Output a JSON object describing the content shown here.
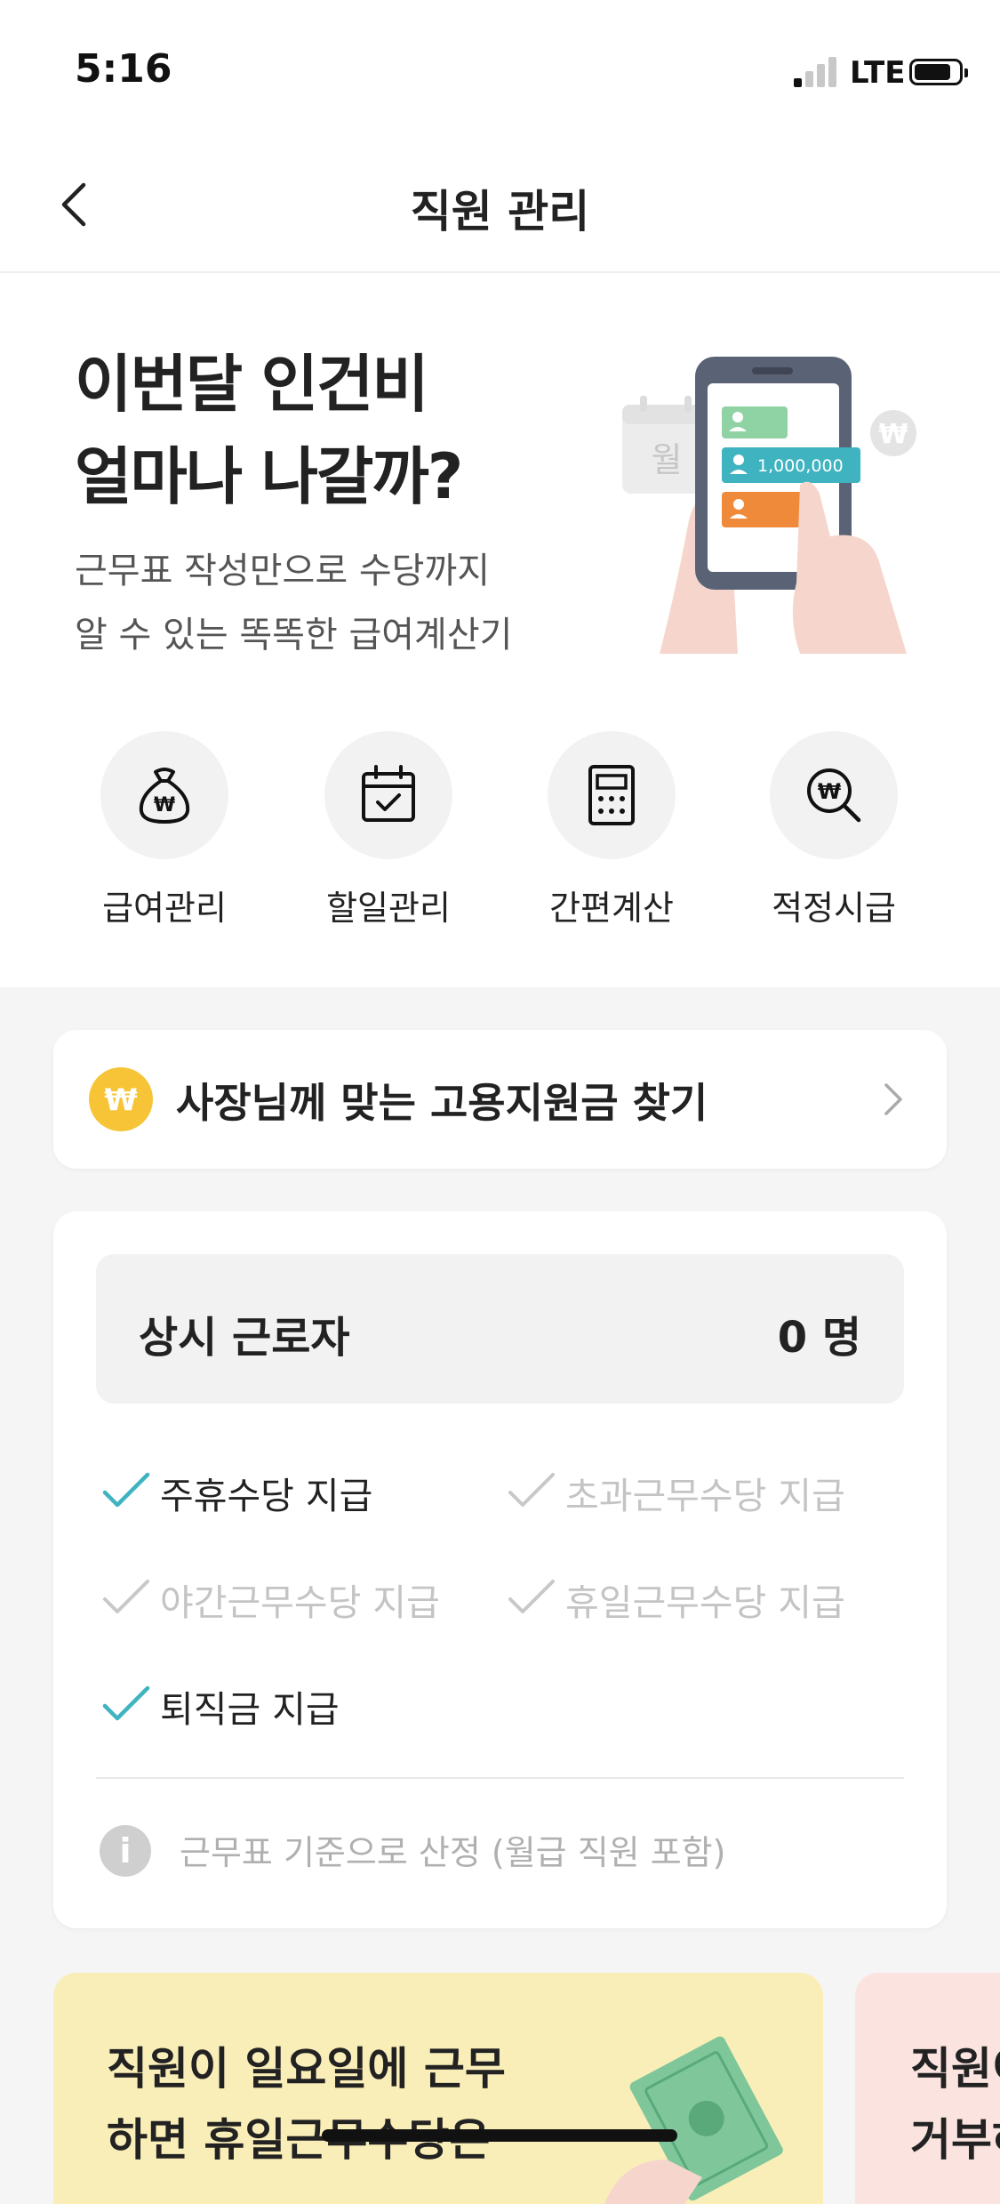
{
  "status_bar": {
    "time": "5:16",
    "network": "LTE"
  },
  "nav": {
    "title": "직원 관리"
  },
  "hero": {
    "title_line1": "이번달 인건비",
    "title_line2": "얼마나 나갈까?",
    "sub_line1": "근무표 작성만으로 수당까지",
    "sub_line2": "알 수 있는 똑똑한 급여계산기",
    "illustration": {
      "calendar_label": "월",
      "amount_label": "1,000,000",
      "coin_symbol": "₩"
    }
  },
  "quick_menu": [
    {
      "label": "급여관리",
      "icon": "money-bag-icon"
    },
    {
      "label": "할일관리",
      "icon": "calendar-check-icon"
    },
    {
      "label": "간편계산",
      "icon": "calculator-icon"
    },
    {
      "label": "적정시급",
      "icon": "won-search-icon"
    }
  ],
  "subsidy": {
    "label": "사장님께 맞는 고용지원금 찾기",
    "icon_symbol": "₩"
  },
  "workers": {
    "title": "상시 근로자",
    "count": "0 명",
    "checks": [
      {
        "label": "주휴수당 지급",
        "checked": true
      },
      {
        "label": "초과근무수당 지급",
        "checked": false
      },
      {
        "label": "야간근무수당 지급",
        "checked": false
      },
      {
        "label": "휴일근무수당 지급",
        "checked": false
      },
      {
        "label": "퇴직금 지급",
        "checked": true
      }
    ],
    "note": "근무표 기준으로 산정 (월급 직원 포함)",
    "info_symbol": "i"
  },
  "promos": [
    {
      "line1": "직원이 일요일에 근무",
      "line2": "하면 휴일근무수당은"
    },
    {
      "line1": "직원이",
      "line2": "거부하"
    }
  ],
  "colors": {
    "accent_teal": "#3fb3c0",
    "coin_yellow": "#f6c436",
    "promo_yellow": "#faeeb8",
    "promo_pink": "#fbe4df"
  }
}
